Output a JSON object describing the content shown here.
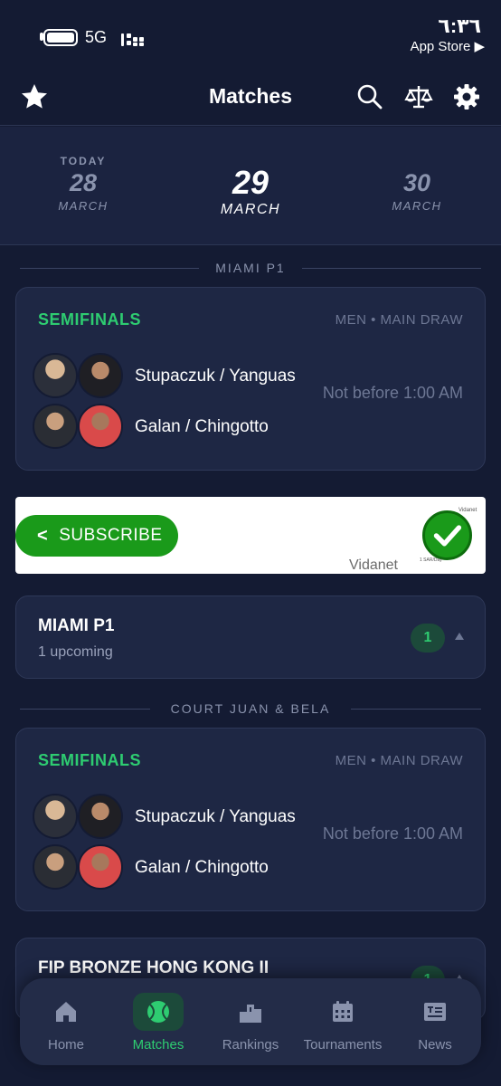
{
  "status_bar": {
    "network": "5G",
    "time": "٦:٣٦",
    "back_app": "App Store ▶"
  },
  "header": {
    "title": "Matches",
    "icons": [
      "star-icon",
      "search-icon",
      "scale-icon",
      "gear-icon"
    ]
  },
  "dates": [
    {
      "today": "TODAY",
      "day": "28",
      "month": "MARCH"
    },
    {
      "today": "",
      "day": "29",
      "month": "MARCH"
    },
    {
      "today": "",
      "day": "30",
      "month": "MARCH"
    }
  ],
  "sections": [
    {
      "label": "MIAMI P1",
      "match": {
        "round": "SEMIFINALS",
        "draw": "MEN • MAIN DRAW",
        "team1": "Stupaczuk / Yanguas",
        "team2": "Galan / Chingotto",
        "time": "Not before 1:00 AM"
      }
    },
    {
      "label": "COURT JUAN & BELA",
      "match": {
        "round": "SEMIFINALS",
        "draw": "MEN • MAIN DRAW",
        "team1": "Stupaczuk / Yanguas",
        "team2": "Galan / Chingotto",
        "time": "Not before 1:00 AM"
      }
    }
  ],
  "ad": {
    "button": "SUBSCRIBE",
    "brand": "Vidanet",
    "tiny_top": "Vidanet",
    "tiny_bottom": "1 SAR/Day"
  },
  "tournaments": [
    {
      "title": "MIAMI P1",
      "subtitle": "1 upcoming",
      "count": "1"
    },
    {
      "title": "FIP BRONZE HONG KONG II",
      "subtitle": "",
      "count": "1"
    }
  ],
  "nav": [
    {
      "label": "Home",
      "icon": "home-icon",
      "active": false
    },
    {
      "label": "Matches",
      "icon": "tennis-ball-icon",
      "active": true
    },
    {
      "label": "Rankings",
      "icon": "podium-icon",
      "active": false
    },
    {
      "label": "Tournaments",
      "icon": "calendar-icon",
      "active": false
    },
    {
      "label": "News",
      "icon": "newspaper-icon",
      "active": false
    }
  ],
  "colors": {
    "background": "#141b33",
    "card": "#1e2744",
    "accent_green": "#2ecc71",
    "muted": "#6d7794",
    "ad_green": "#1a9a1a"
  }
}
